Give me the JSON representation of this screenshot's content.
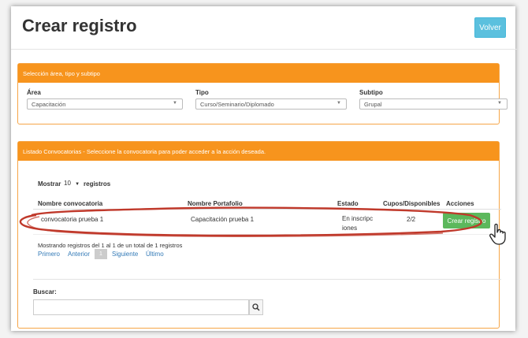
{
  "header": {
    "title": "Crear registro",
    "back_label": "Volver"
  },
  "filters": {
    "panel_title": "Selección área, tipo y subtipo",
    "area": {
      "label": "Área",
      "value": "Capacitación"
    },
    "tipo": {
      "label": "Tipo",
      "value": "Curso/Seminario/Diplomado"
    },
    "subtipo": {
      "label": "Subtipo",
      "value": "Grupal"
    }
  },
  "listing": {
    "panel_title": "Listado Convocatorias - Seleccione la convocatoria para poder acceder a la acción deseada.",
    "show_label": "Mostrar",
    "show_value": "10",
    "records_label": "registros",
    "columns": [
      "Nombre convocatoria",
      "Nombre Portafolio",
      "Estado",
      "Cupos/Disponibles",
      "Acciones"
    ],
    "rows": [
      {
        "convocatoria": "convocatoria prueba 1",
        "portafolio": "Capacitación prueba 1",
        "estado_line1": "En inscripc",
        "estado_line2": "iones",
        "cupos": "2/2",
        "action_label": "Crear registro"
      }
    ],
    "info": "Mostrando registros del 1 al 1 de un total de 1 registros",
    "pagination": {
      "first": "Primero",
      "previous": "Anterior",
      "current": "1",
      "next": "Siguiente",
      "last": "Último"
    }
  },
  "search": {
    "label": "Buscar:",
    "value": ""
  },
  "colors": {
    "accent": "#f7941d",
    "highlight": "#c0392b",
    "action": "#5cb85c",
    "back": "#5bc0de"
  }
}
